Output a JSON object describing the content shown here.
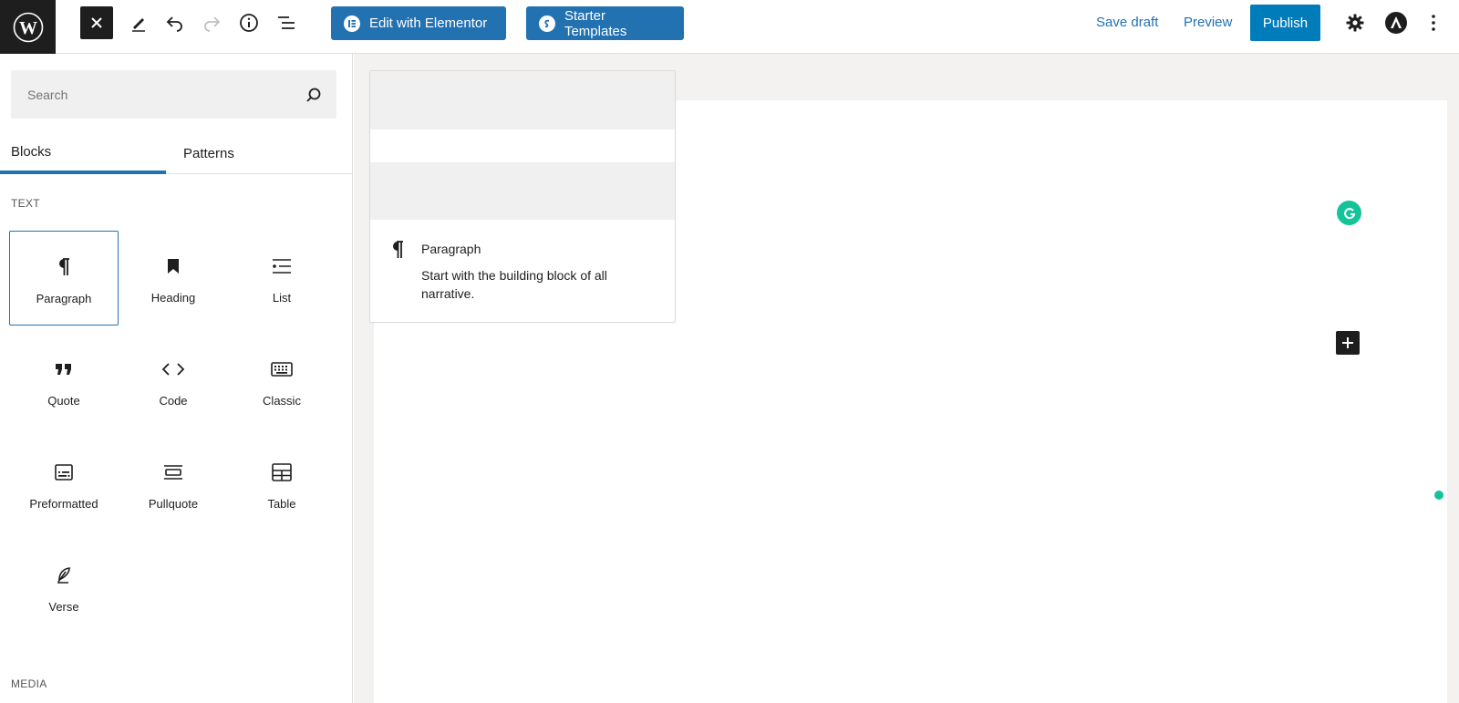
{
  "toolbar": {
    "elementor_label": "Edit with Elementor",
    "starter_label": "Starter Templates",
    "save_draft": "Save draft",
    "preview": "Preview",
    "publish": "Publish"
  },
  "inserter": {
    "search_placeholder": "Search",
    "tabs": [
      "Blocks",
      "Patterns"
    ],
    "section_text": "TEXT",
    "section_media": "MEDIA",
    "blocks": [
      {
        "label": "Paragraph",
        "icon": "paragraph-icon"
      },
      {
        "label": "Heading",
        "icon": "bookmark-icon"
      },
      {
        "label": "List",
        "icon": "list-icon"
      },
      {
        "label": "Quote",
        "icon": "quote-icon"
      },
      {
        "label": "Code",
        "icon": "code-icon"
      },
      {
        "label": "Classic",
        "icon": "keyboard-icon"
      },
      {
        "label": "Preformatted",
        "icon": "preformatted-icon"
      },
      {
        "label": "Pullquote",
        "icon": "pullquote-icon"
      },
      {
        "label": "Table",
        "icon": "table-icon"
      },
      {
        "label": "Verse",
        "icon": "feather-icon"
      }
    ]
  },
  "preview": {
    "title": "Paragraph",
    "description": "Start with the building block of all narrative."
  },
  "colors": {
    "accent": "#2271b1",
    "publish": "#007cba",
    "grammarly": "#15c39a"
  }
}
